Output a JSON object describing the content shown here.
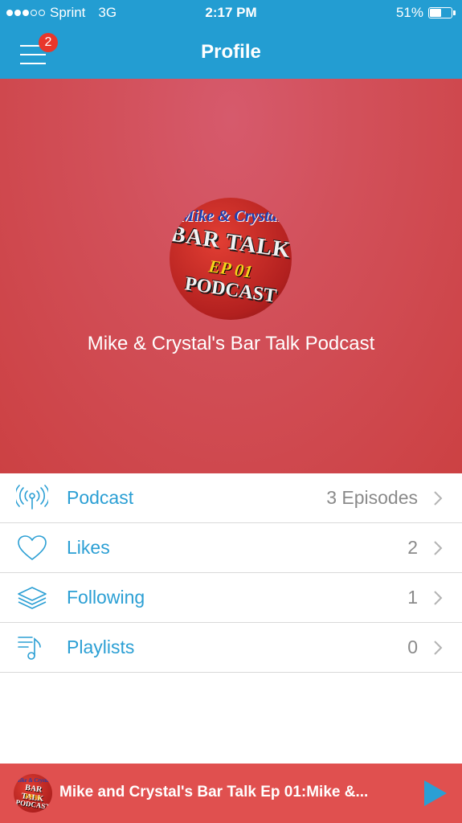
{
  "status_bar": {
    "carrier": "Sprint",
    "network": "3G",
    "time": "2:17 PM",
    "battery_text": "51%",
    "battery_level": 0.51,
    "signal_bars_filled": 3,
    "signal_bars_total": 5
  },
  "nav": {
    "title": "Profile",
    "menu_badge": "2",
    "menu_icon": "hamburger-menu-icon"
  },
  "profile": {
    "name": "Mike & Crystal's Bar Talk Podcast",
    "avatar_logo_text": [
      "Mike & Crystal",
      "BAR TALK",
      "EP 01",
      "PODCAST"
    ]
  },
  "list": [
    {
      "icon": "podcast-broadcast-icon",
      "label": "Podcast",
      "value": "3 Episodes"
    },
    {
      "icon": "heart-icon",
      "label": "Likes",
      "value": "2"
    },
    {
      "icon": "layers-icon",
      "label": "Following",
      "value": "1"
    },
    {
      "icon": "playlist-icon",
      "label": "Playlists",
      "value": "0"
    }
  ],
  "player": {
    "title": "Mike and Crystal's Bar Talk Ep 01:Mike &...",
    "play_icon": "play-icon"
  },
  "colors": {
    "nav_blue": "#239dd2",
    "hero_red": "#cc4143",
    "accent_blue": "#2b9fd4",
    "player_red": "#e0504f"
  }
}
